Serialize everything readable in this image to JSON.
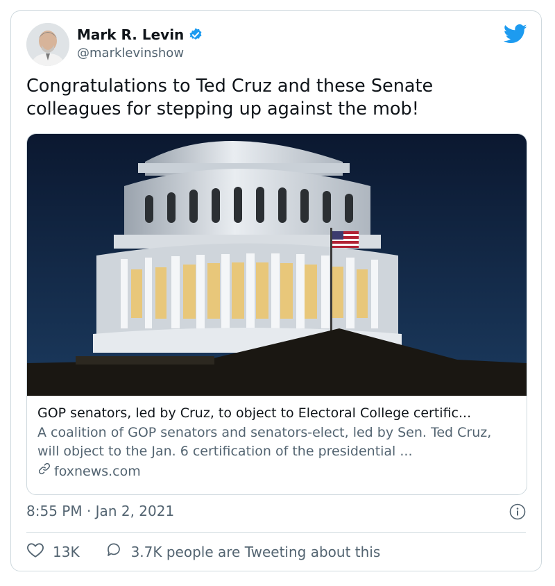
{
  "author": {
    "name": "Mark R. Levin",
    "handle": "@marklevinshow"
  },
  "tweet_text": "Congratulations to Ted Cruz and these Senate colleagues for stepping up against the mob!",
  "link_card": {
    "title": "GOP senators, led by Cruz, to object to Electoral College certific...",
    "description": "A coalition of GOP senators and senators-elect, led by Sen. Ted Cruz, will object to the Jan. 6 certification of the presidential ...",
    "domain": "foxnews.com"
  },
  "timestamp": "8:55 PM · Jan 2, 2021",
  "actions": {
    "likes": "13K",
    "tweeting": "3.7K people are Tweeting about this"
  },
  "colors": {
    "brand": "#1d9bf0",
    "text": "#0f1419",
    "secondary": "#536471",
    "border": "#cfd9de"
  },
  "icons": [
    "verified-badge-icon",
    "twitter-bird-icon",
    "link-icon",
    "info-icon",
    "heart-icon",
    "reply-bubble-icon"
  ]
}
